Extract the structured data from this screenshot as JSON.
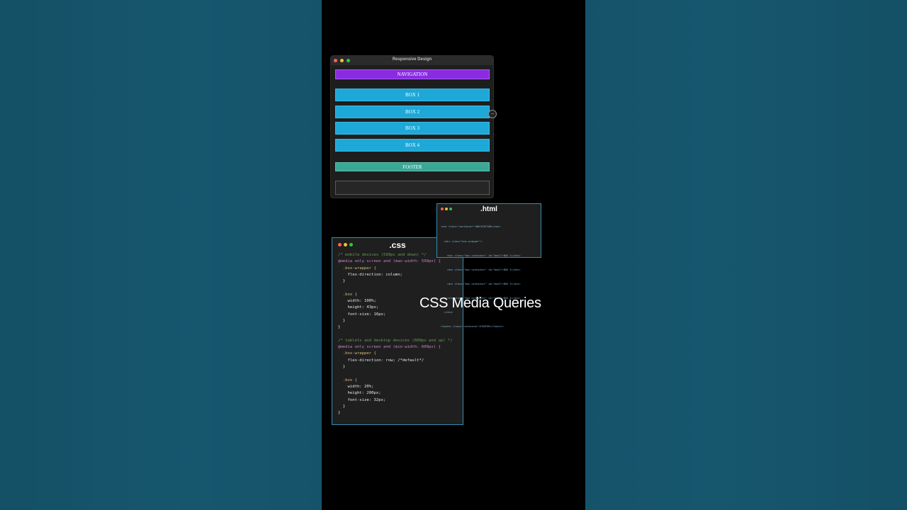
{
  "browser": {
    "title": "Responsive Design",
    "nav_label": "NAVIGATION",
    "boxes": [
      "BOX 1",
      "BOX 2",
      "BOX 3",
      "BOX 4"
    ],
    "footer_label": "FOOTER",
    "resize_handle_icon": "resize-arrows-icon"
  },
  "html_panel": {
    "title": ".html",
    "lines": [
      "<nav class=\"container\">NAVIGATION</nav>",
      "  <div class=\"box-wrapper\">",
      "    <div class=\"box container\" id=\"box1\">BOX 1</div>",
      "    <div class=\"box container\" id=\"box2\">BOX 2</div>",
      "    <div class=\"box container\" id=\"box3\">BOX 3</div>",
      "    <div class=\"box container\" id=\"box4\">BOX 4</div>",
      "  </div>",
      "<footer class=\"container\">FOOTER</footer>"
    ]
  },
  "css_panel": {
    "title": ".css",
    "lines": [
      {
        "text": "/* mobile devices (599px and down) */",
        "kind": "comment"
      },
      {
        "text": "@media only screen and (max-width: 599px) {",
        "kind": "media"
      },
      {
        "text": "  .box-wrapper {",
        "kind": "selector"
      },
      {
        "text": "    flex-direction: column;",
        "kind": "prop"
      },
      {
        "text": "  }",
        "kind": "plain"
      },
      {
        "text": "",
        "kind": "plain"
      },
      {
        "text": "  .box {",
        "kind": "selector"
      },
      {
        "text": "    width: 100%;",
        "kind": "prop"
      },
      {
        "text": "    height: 43px;",
        "kind": "prop"
      },
      {
        "text": "    font-size: 16px;",
        "kind": "prop"
      },
      {
        "text": "  }",
        "kind": "plain"
      },
      {
        "text": "}",
        "kind": "plain"
      },
      {
        "text": "",
        "kind": "plain"
      },
      {
        "text": "/* tablets and desktop devices (600px and up) */",
        "kind": "comment"
      },
      {
        "text": "@media only screen and (min-width: 600px) {",
        "kind": "media"
      },
      {
        "text": "  .box-wrapper {",
        "kind": "selector"
      },
      {
        "text": "    flex-direction: row; /*default*/",
        "kind": "prop"
      },
      {
        "text": "  }",
        "kind": "plain"
      },
      {
        "text": "",
        "kind": "plain"
      },
      {
        "text": "  .box {",
        "kind": "selector"
      },
      {
        "text": "    width: 20%;",
        "kind": "prop"
      },
      {
        "text": "    height: 200px;",
        "kind": "prop"
      },
      {
        "text": "    font-size: 32px;",
        "kind": "prop"
      },
      {
        "text": "  }",
        "kind": "plain"
      },
      {
        "text": "}",
        "kind": "plain"
      }
    ]
  },
  "caption": "CSS Media Queries",
  "colors": {
    "background": "#15536a",
    "navigation": "#8a2be2",
    "box": "#1ea8d8",
    "footer": "#3aa895",
    "panel_border": "#2f8fb0"
  }
}
